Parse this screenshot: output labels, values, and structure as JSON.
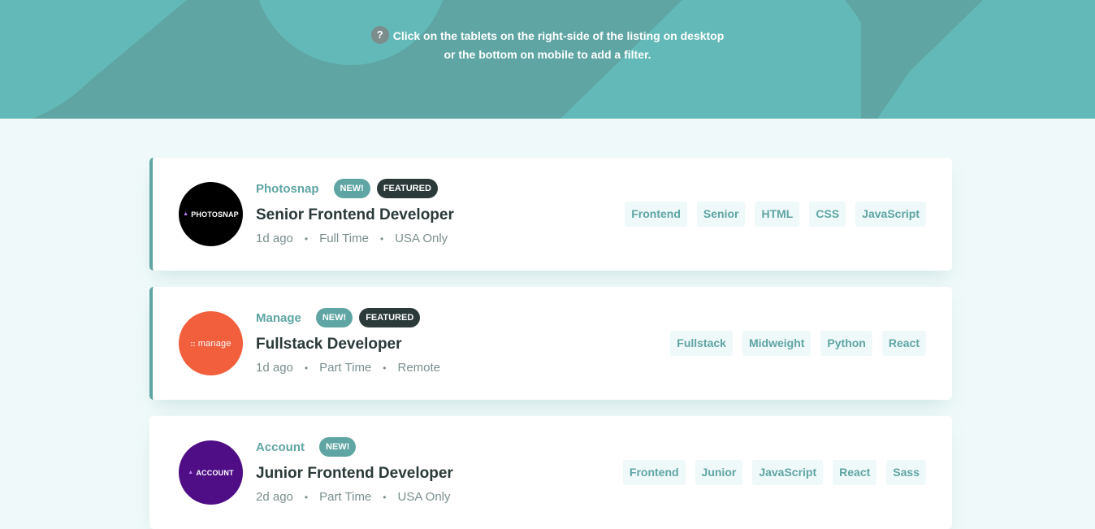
{
  "header": {
    "hint_icon": "?",
    "hint_line1": "Click on the tablets on the right-side of the listing on desktop",
    "hint_line2": "or the bottom on mobile to add a filter.",
    "bg_color": "#5ea5a3"
  },
  "colors": {
    "primary": "#5ea5a3",
    "dark": "#2b3939",
    "muted": "#7b8e8e",
    "background": "#eff9f9"
  },
  "jobs": [
    {
      "logo_text": "PHOTOSNAP",
      "logo_icon": "triangle-icon",
      "logo_color": "#000000",
      "company": "Photosnap",
      "new": "NEW!",
      "featured": "FEATURED",
      "position": "Senior Frontend Developer",
      "posted": "1d ago",
      "contract": "Full Time",
      "location": "USA Only",
      "tags": [
        "Frontend",
        "Senior",
        "HTML",
        "CSS",
        "JavaScript"
      ]
    },
    {
      "logo_text": "manage",
      "logo_icon": "dots-icon",
      "logo_color": "#f15f3c",
      "company": "Manage",
      "new": "NEW!",
      "featured": "FEATURED",
      "position": "Fullstack Developer",
      "posted": "1d ago",
      "contract": "Part Time",
      "location": "Remote",
      "tags": [
        "Fullstack",
        "Midweight",
        "Python",
        "React"
      ]
    },
    {
      "logo_text": "ACCOUNT",
      "logo_icon": "triangle-icon",
      "logo_color": "#4f0e85",
      "company": "Account",
      "new": "NEW!",
      "position": "Junior Frontend Developer",
      "posted": "2d ago",
      "contract": "Part Time",
      "location": "USA Only",
      "tags": [
        "Frontend",
        "Junior",
        "JavaScript",
        "React",
        "Sass"
      ]
    }
  ]
}
